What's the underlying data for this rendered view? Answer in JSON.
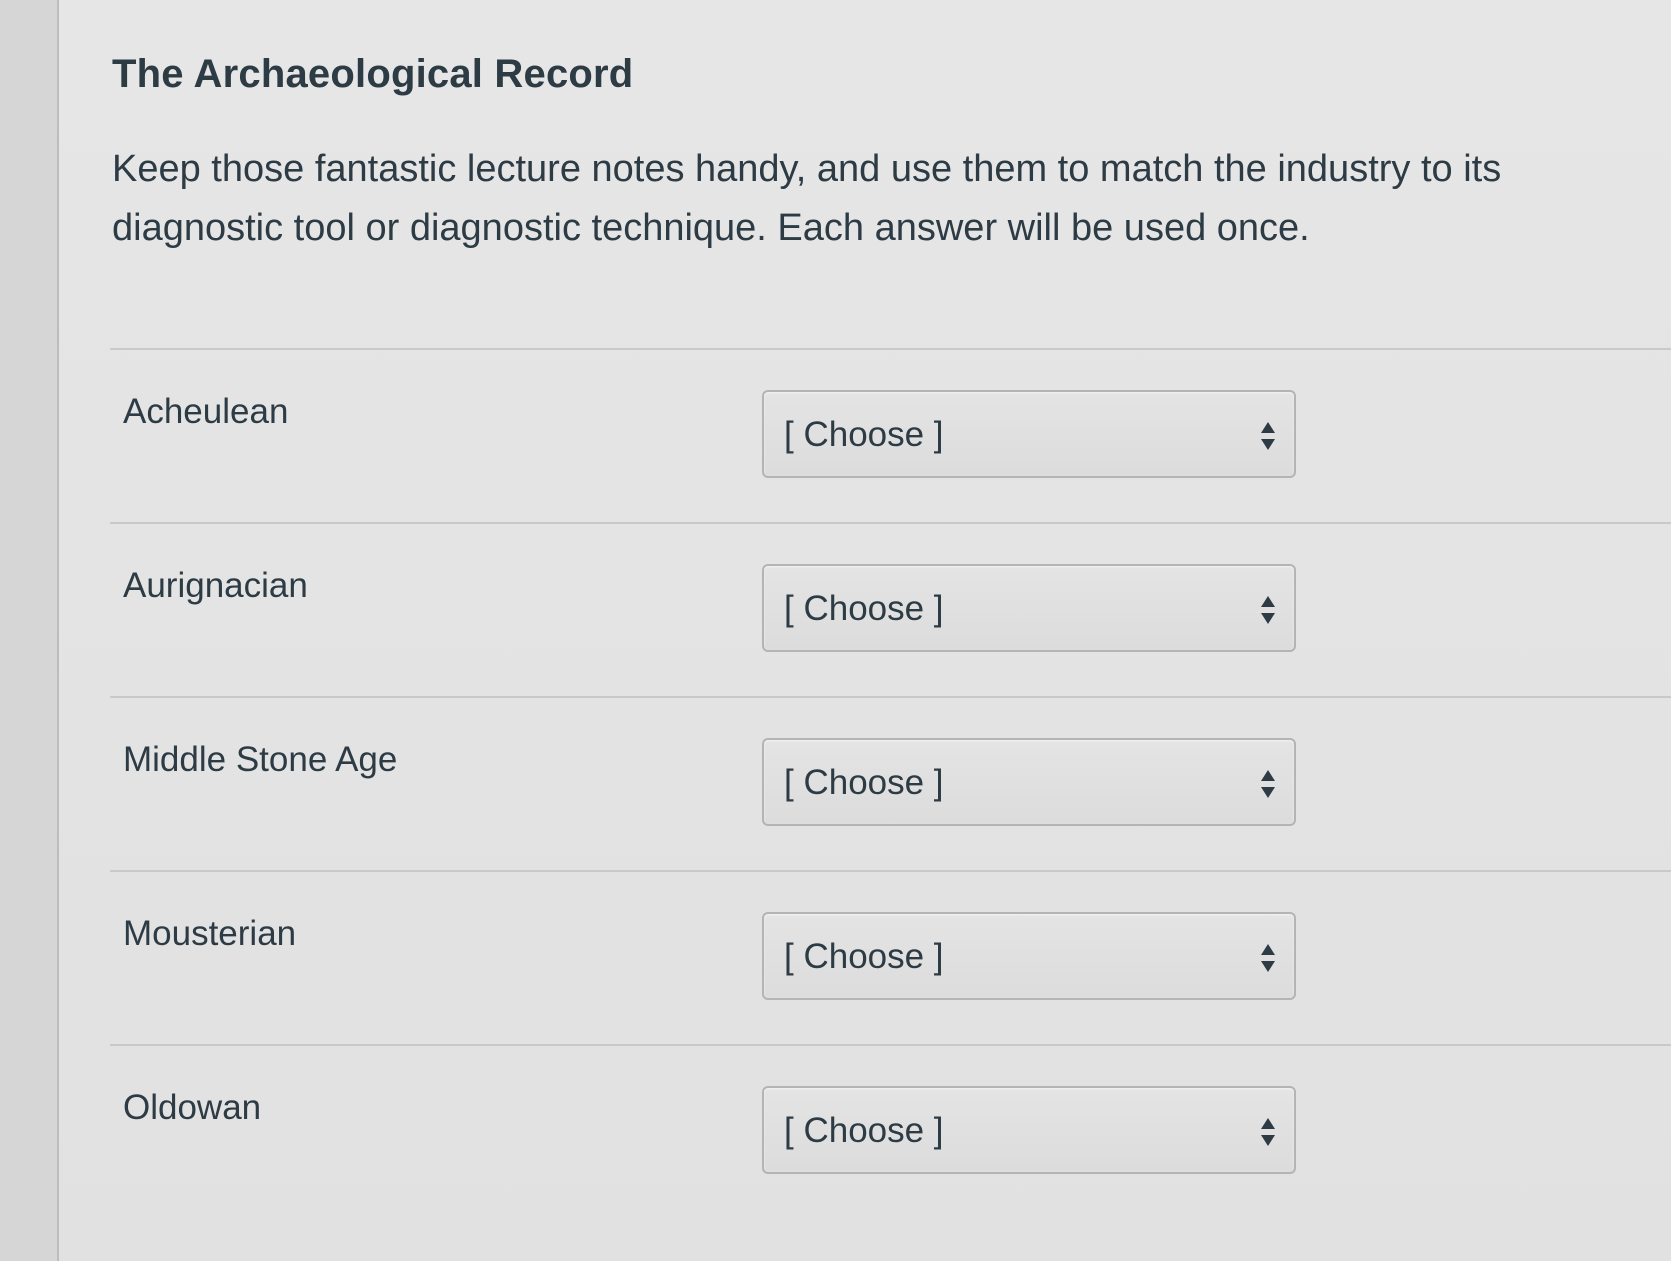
{
  "quiz": {
    "title": "The Archaeological Record",
    "instructions": "Keep those fantastic lecture notes handy, and use them to match the industry to its diagnostic tool or diagnostic technique.  Each answer will be used once."
  },
  "matching": {
    "rows": [
      {
        "label": "Acheulean",
        "selected": "[ Choose ]"
      },
      {
        "label": "Aurignacian",
        "selected": "[ Choose ]"
      },
      {
        "label": "Middle Stone Age",
        "selected": "[ Choose ]"
      },
      {
        "label": "Mousterian",
        "selected": "[ Choose ]"
      },
      {
        "label": "Oldowan",
        "selected": "[ Choose ]"
      }
    ]
  },
  "icons": {
    "select_arrows": "up-down-sort-icon"
  },
  "colors": {
    "text": "#2d3b45",
    "divider": "#c9c9c9",
    "select_border": "#b4b4b4"
  }
}
